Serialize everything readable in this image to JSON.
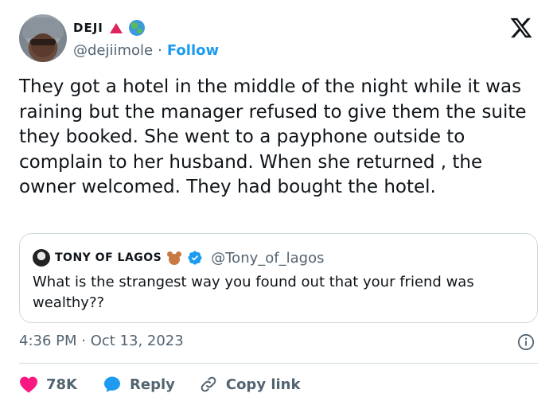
{
  "author": {
    "display_name": "DEJI",
    "handle": "@dejiimole",
    "separator": "·",
    "follow_label": "Follow",
    "badges": [
      "triangle-up-icon",
      "globe-icon"
    ]
  },
  "logo": "x-logo-icon",
  "tweet": {
    "text": "They got a hotel in the middle of the night while it was raining but the manager refused to give them the suite they booked. She went to a payphone outside to complain to her husband. When she returned , the owner welcomed. They had bought the hotel."
  },
  "quoted": {
    "display_name": "TONY OF LAGOS",
    "handle": "@Tony_of_lagos",
    "text": "What is the strangest way you found out that your friend was wealthy??"
  },
  "meta": {
    "timestamp": "4:36 PM · Oct 13, 2023"
  },
  "actions": {
    "likes_count": "78K",
    "reply_label": "Reply",
    "copy_link_label": "Copy link"
  },
  "colors": {
    "accent": "#1d9bf0",
    "like": "#f91880",
    "muted": "#536471"
  }
}
